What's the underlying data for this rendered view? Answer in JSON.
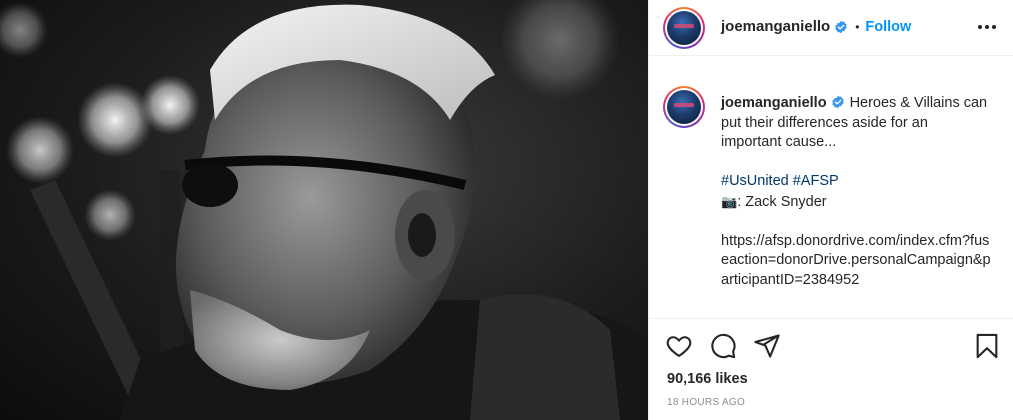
{
  "photo": {
    "alt": "",
    "tone": "black-and-white"
  },
  "header": {
    "username": "joemanganiello",
    "separator": "•",
    "follow_label": "Follow",
    "verified": true
  },
  "caption": {
    "username": "joemanganiello",
    "line1": "Heroes & Villains can put their differences aside for an important cause...",
    "hashtag1": "#UsUnited",
    "hashtag2": "#AFSP",
    "camera_emoji": "📷",
    "credit": ": Zack Snyder",
    "url": "https://afsp.donordrive.com/index.cfm?fuseaction=donorDrive.personalCampaign&participantID=2384952"
  },
  "stats": {
    "likes": "90,166 likes",
    "timestamp": "18 HOURS AGO"
  },
  "icons": {
    "like": "heart-icon",
    "comment": "comment-icon",
    "share": "share-icon",
    "save": "bookmark-icon",
    "more": "more-options-icon",
    "verified": "verified-badge-icon"
  },
  "colors": {
    "follow": "#0095f6",
    "hashtag": "#00376b",
    "verified": "#3897f0",
    "muted": "#8e8e8e",
    "text": "#262626"
  }
}
